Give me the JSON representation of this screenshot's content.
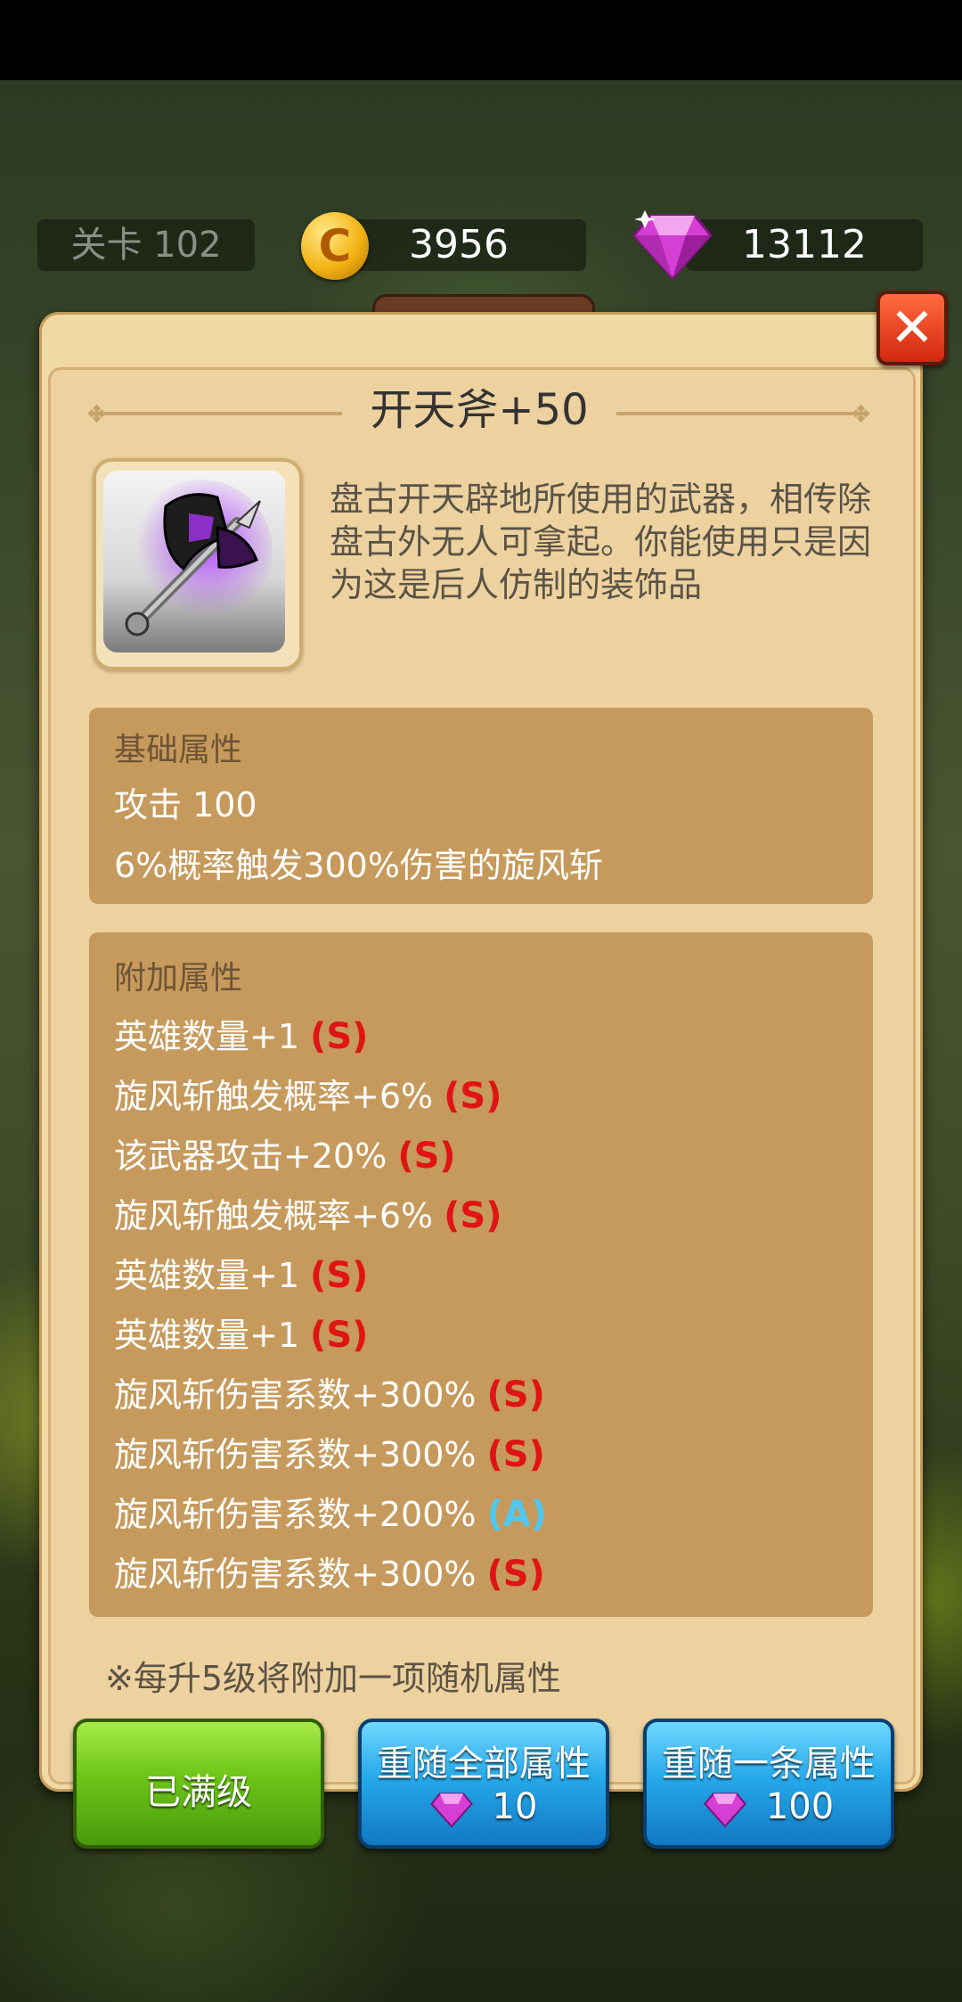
{
  "topbar": {
    "stage_label": "关卡 102",
    "coins": "3956",
    "gems": "13112",
    "icons": {
      "coin": "coin-icon",
      "gem": "gem-icon"
    }
  },
  "item": {
    "title": "开天斧+50",
    "description": "盘古开天辟地所使用的武器，相传除盘古外无人可拿起。你能使用只是因为这是后人仿制的装饰品",
    "icon": "battle-axe-icon"
  },
  "basic": {
    "header": "基础属性",
    "lines": [
      "攻击 100",
      "6%概率触发300%伤害的旋风斩"
    ]
  },
  "extra": {
    "header": "附加属性",
    "lines": [
      {
        "text": "英雄数量+1",
        "grade": "(S)"
      },
      {
        "text": "旋风斩触发概率+6%",
        "grade": "(S)"
      },
      {
        "text": "该武器攻击+20%",
        "grade": "(S)"
      },
      {
        "text": "旋风斩触发概率+6%",
        "grade": "(S)"
      },
      {
        "text": "英雄数量+1",
        "grade": "(S)"
      },
      {
        "text": "英雄数量+1",
        "grade": "(S)"
      },
      {
        "text": "旋风斩伤害系数+300%",
        "grade": "(S)"
      },
      {
        "text": "旋风斩伤害系数+300%",
        "grade": "(S)"
      },
      {
        "text": "旋风斩伤害系数+200%",
        "grade": "(A)"
      },
      {
        "text": "旋风斩伤害系数+300%",
        "grade": "(S)"
      }
    ]
  },
  "note": "※每升5级将附加一项随机属性",
  "buttons": {
    "maxed": "已满级",
    "reroll_all": {
      "label": "重随全部属性",
      "cost": "10"
    },
    "reroll_one": {
      "label": "重随一条属性",
      "cost": "100"
    }
  },
  "colors": {
    "grade_s": "#e01414",
    "grade_a": "#4fc8ef",
    "panel": "#edd2a0",
    "attr_box": "#c69a5c"
  }
}
